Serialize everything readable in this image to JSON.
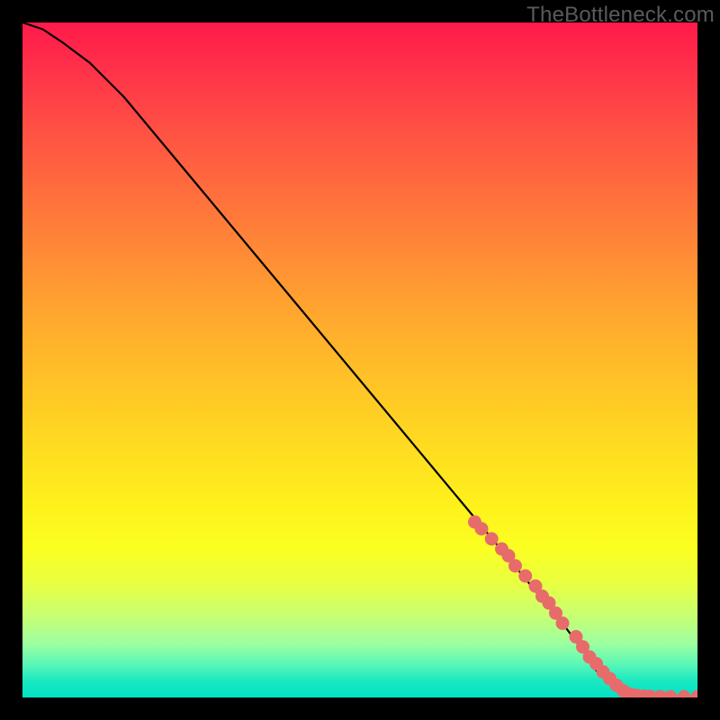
{
  "watermark": "TheBottleneck.com",
  "chart_data": {
    "type": "line",
    "title": "",
    "xlabel": "",
    "ylabel": "",
    "xlim": [
      0,
      100
    ],
    "ylim": [
      0,
      100
    ],
    "background_gradient": {
      "orientation": "vertical",
      "stops": [
        {
          "pos": 0,
          "color": "#ff1a4a"
        },
        {
          "pos": 50,
          "color": "#ffc526"
        },
        {
          "pos": 80,
          "color": "#f5ff2e"
        },
        {
          "pos": 95,
          "color": "#5cf7b6"
        },
        {
          "pos": 100,
          "color": "#00e2c4"
        }
      ]
    },
    "series": [
      {
        "name": "curve",
        "color": "#000000",
        "x": [
          0,
          3,
          6,
          10,
          15,
          20,
          30,
          40,
          50,
          60,
          70,
          75,
          80,
          83,
          85,
          88,
          92,
          96,
          100
        ],
        "y": [
          100,
          99,
          97,
          94,
          89,
          83,
          71,
          59,
          47,
          35,
          23,
          17,
          11,
          7,
          4,
          1,
          0,
          0,
          0
        ]
      },
      {
        "name": "highlight-points",
        "color": "#e86b6b",
        "type": "scatter",
        "x": [
          67,
          68,
          69.5,
          71,
          72,
          73,
          74.5,
          76,
          77,
          78,
          79,
          80,
          82,
          83,
          84,
          85,
          86,
          87,
          88,
          89,
          90,
          91,
          92,
          93,
          94.5,
          96,
          98,
          100
        ],
        "y": [
          26,
          25,
          23.5,
          22,
          21,
          19.5,
          18,
          16.5,
          15,
          14,
          12.5,
          11,
          9,
          7.5,
          6,
          5,
          3.8,
          2.8,
          1.8,
          1,
          0.5,
          0.3,
          0.2,
          0.15,
          0.12,
          0.1,
          0.1,
          0.1
        ]
      }
    ]
  }
}
